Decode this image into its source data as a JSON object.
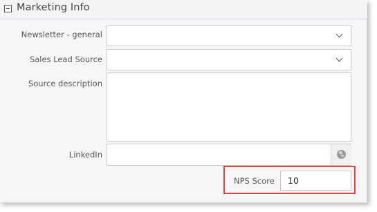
{
  "section": {
    "title": "Marketing Info",
    "collapse_icon": "minus-square-icon"
  },
  "fields": {
    "newsletter": {
      "label": "Newsletter - general",
      "value": "",
      "icon": "chevron-down-icon"
    },
    "sales_lead_source": {
      "label": "Sales Lead Source",
      "value": "",
      "icon": "chevron-down-icon"
    },
    "source_description": {
      "label": "Source description",
      "value": ""
    },
    "linkedin": {
      "label": "LinkedIn",
      "value": "",
      "icon": "globe-icon"
    },
    "nps_score": {
      "label": "NPS Score",
      "value": "10"
    }
  },
  "colors": {
    "highlight_border": "#e04444",
    "header_underline": "#cfd7e3",
    "panel_background": "#f6f6f6"
  }
}
